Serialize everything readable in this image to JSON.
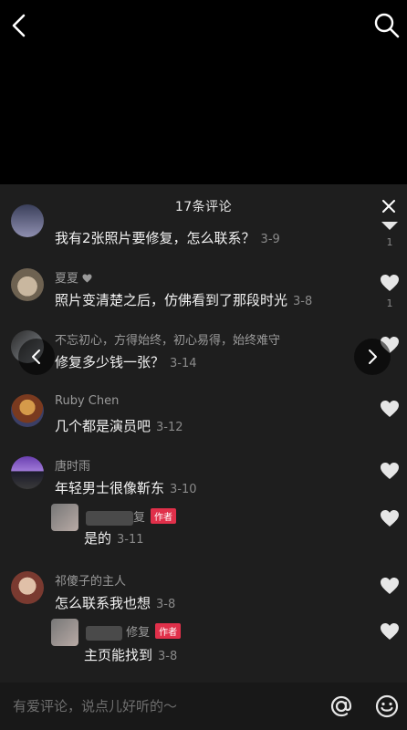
{
  "header": {
    "comment_count_title": "17条评论"
  },
  "comments": [
    {
      "username": "",
      "text": "我有2张照片要修复，怎么联系？",
      "time": "3-9",
      "likes": "1"
    },
    {
      "username": "夏夏",
      "text": "照片变清楚之后，仿佛看到了那段时光",
      "time": "3-8",
      "likes": "1"
    },
    {
      "username": "不忘初心，方得始终，初心易得，始终难守",
      "text": "修复多少钱一张？",
      "time": "3-14",
      "likes": ""
    },
    {
      "username": "Ruby  Chen",
      "text": "几个都是演员吧",
      "time": "3-12",
      "likes": ""
    },
    {
      "username": "唐时雨",
      "text": "年轻男士很像靳东",
      "time": "3-10",
      "likes": ""
    },
    {
      "username": "祁傻子的主人",
      "text": "怎么联系我也想",
      "time": "3-8",
      "likes": ""
    }
  ],
  "replies": [
    {
      "username_visible": "复",
      "author_tag": "作者",
      "text": "是的",
      "time": "3-11"
    },
    {
      "username_visible": "修复",
      "author_tag": "作者",
      "text": "主页能找到",
      "time": "3-8"
    }
  ],
  "input": {
    "placeholder": "有爱评论，说点儿好听的～"
  },
  "colors": {
    "sheet_bg": "#1e1e1e",
    "author_tag": "#e0304a",
    "background": "#000000"
  },
  "icons": [
    "back-icon",
    "search-icon",
    "close-icon",
    "heart-icon",
    "chevron-left-icon",
    "chevron-right-icon",
    "at-icon",
    "emoji-icon"
  ]
}
